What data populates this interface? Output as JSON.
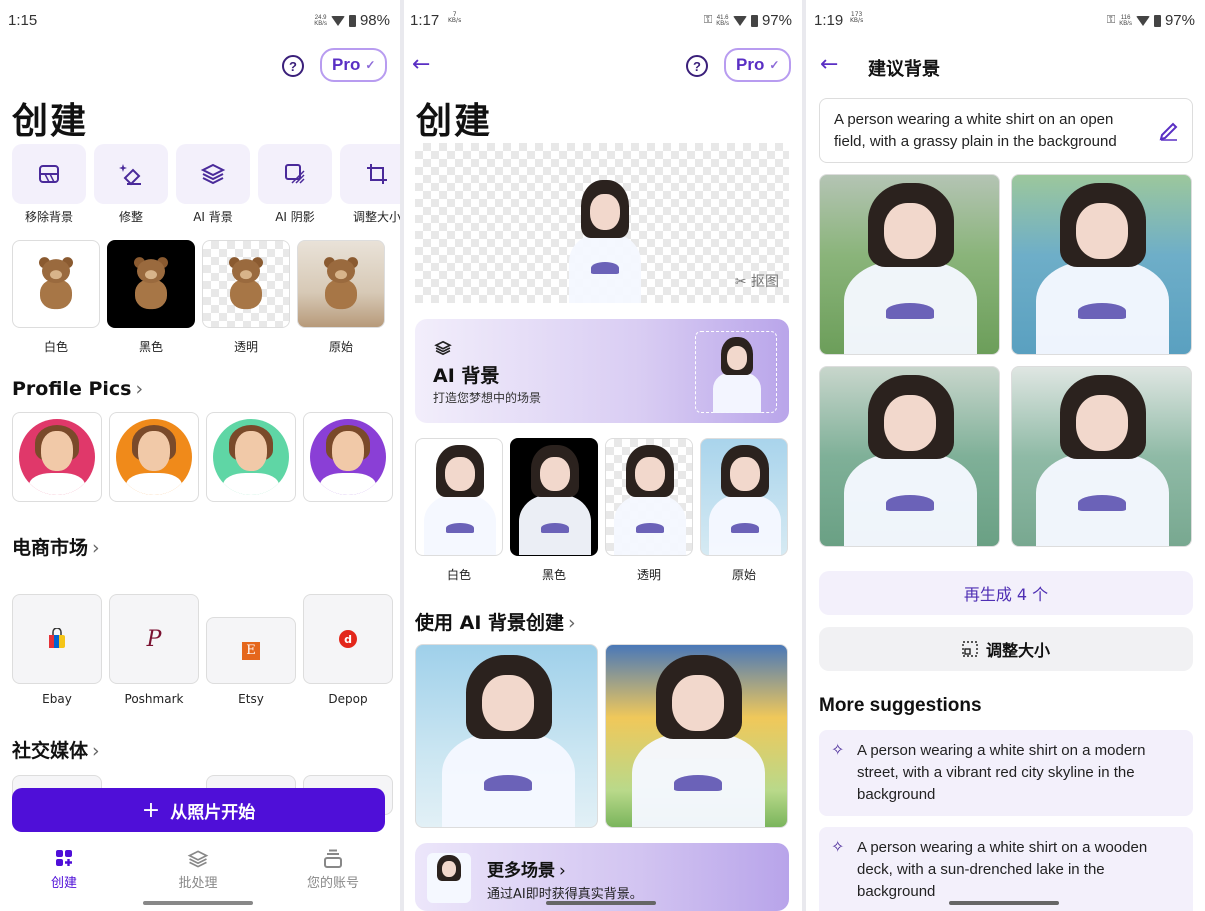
{
  "screen1": {
    "status": {
      "time": "1:15",
      "net_value": "24.9",
      "net_unit": "KB/s",
      "battery": "98%"
    },
    "pro_label": "Pro",
    "title": "创建",
    "tools": [
      {
        "label": "移除背景",
        "icon": "remove-bg-icon"
      },
      {
        "label": "修整",
        "icon": "retouch-icon"
      },
      {
        "label": "AI 背景",
        "icon": "layers-icon"
      },
      {
        "label": "AI 阴影",
        "icon": "shadow-icon"
      },
      {
        "label": "调整大小",
        "icon": "crop-icon"
      }
    ],
    "bg_options": [
      "白色",
      "黑色",
      "透明",
      "原始"
    ],
    "profile_title": "Profile Pics",
    "profile_colors": [
      "#e0386a",
      "#f08a1a",
      "#5fd6a5",
      "#8a3fd6"
    ],
    "ecommerce_title": "电商市场",
    "shops": [
      {
        "name": "Ebay",
        "icon": "ebay-bag-icon"
      },
      {
        "name": "Poshmark",
        "logo": "P"
      },
      {
        "name": "Etsy",
        "logo": "E"
      },
      {
        "name": "Depop",
        "logo": "d"
      }
    ],
    "social_title": "社交媒体",
    "cta_label": "从照片开始",
    "cta_icon": "+",
    "tabs": [
      {
        "label": "创建",
        "icon": "grid-icon"
      },
      {
        "label": "批处理",
        "icon": "layers-icon"
      },
      {
        "label": "您的账号",
        "icon": "account-stack-icon"
      }
    ]
  },
  "screen2": {
    "status": {
      "time": "1:17",
      "net_value1": "7",
      "net_unit1": "KB/s",
      "net_value2": "41.6",
      "net_unit2": "KB/s",
      "battery": "97%"
    },
    "pro_label": "Pro",
    "title": "创建",
    "cutout_label": "抠图",
    "ai_card": {
      "title": "AI 背景",
      "subtitle": "打造您梦想中的场景"
    },
    "bg_options": [
      "白色",
      "黑色",
      "透明",
      "原始"
    ],
    "create_with_ai_title": "使用 AI 背景创建",
    "more_scenes": {
      "title": "更多场景",
      "subtitle": "通过AI即时获得真实背景。"
    }
  },
  "screen3": {
    "status": {
      "time": "1:19",
      "net_value1": "173",
      "net_unit1": "KB/s",
      "net_value2": "116",
      "net_unit2": "KB/s",
      "battery": "97%"
    },
    "title": "建议背景",
    "prompt": "A person wearing a white shirt on an open field, with a grassy plain in the background",
    "regenerate_label": "再生成 4 个",
    "resize_label": "调整大小",
    "more_title": "More suggestions",
    "suggestions": [
      "A person wearing a white shirt on a modern street, with a vibrant red city skyline in the background",
      "A person wearing a white shirt on a wooden deck, with a sun-drenched lake in the background"
    ]
  },
  "colors": {
    "accent": "#4f0fd8",
    "accent_light": "#f3f0fb",
    "pro_border": "#b89cf0"
  }
}
